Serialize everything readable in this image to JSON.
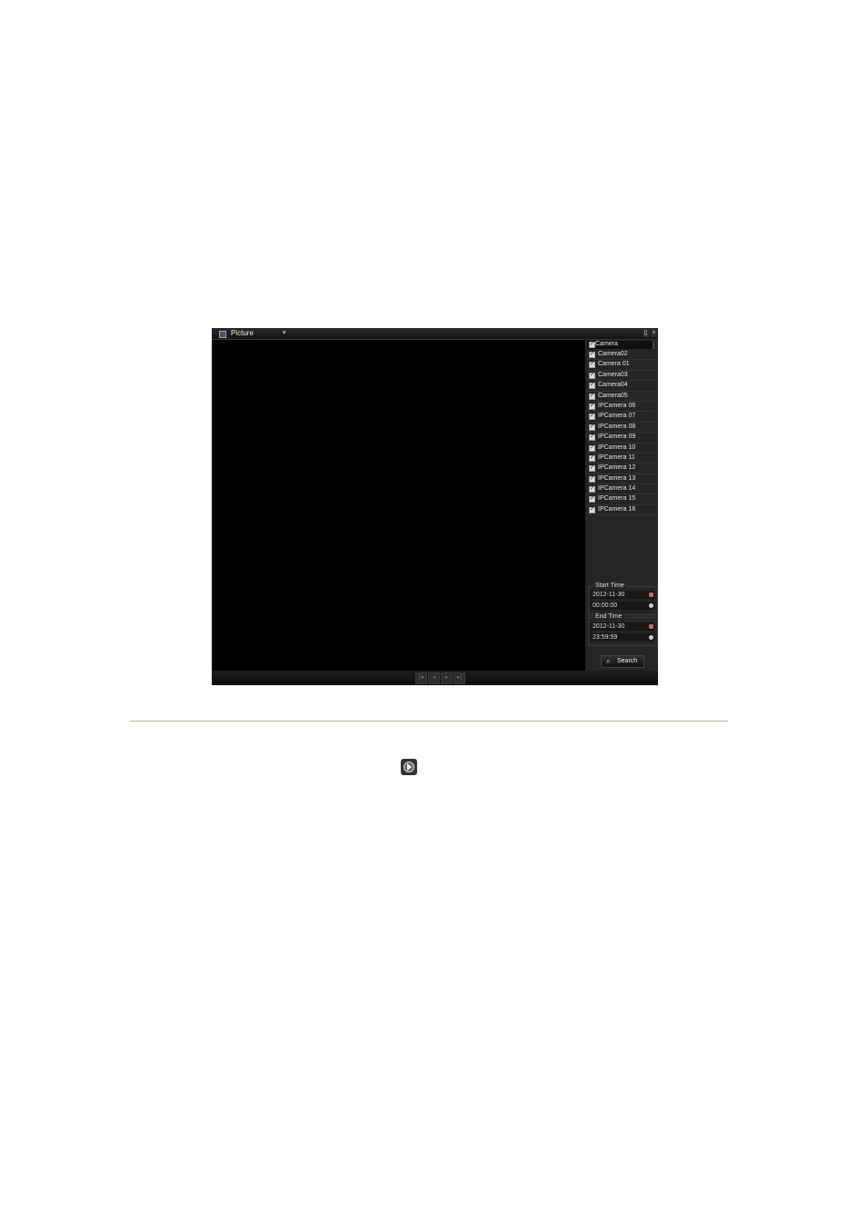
{
  "window": {
    "mode_label": "Picture",
    "dropdown_arrow": "▾",
    "maximize_glyph": "▯",
    "close_glyph": "×"
  },
  "camera_panel": {
    "header_label": "Camera",
    "items": [
      {
        "label": "Camera02"
      },
      {
        "label": "Camera 01"
      },
      {
        "label": "Camera03"
      },
      {
        "label": "Camera04"
      },
      {
        "label": "Camera05"
      },
      {
        "label": "IPCamera 06"
      },
      {
        "label": "IPCamera 07"
      },
      {
        "label": "IPCamera 08"
      },
      {
        "label": "IPCamera 09"
      },
      {
        "label": "IPCamera 10"
      },
      {
        "label": "IPCamera 11"
      },
      {
        "label": "IPCamera 12"
      },
      {
        "label": "IPCamera 13"
      },
      {
        "label": "IPCamera 14"
      },
      {
        "label": "IPCamera 15"
      },
      {
        "label": "IPCamera 16"
      }
    ],
    "check_glyph": "✓"
  },
  "start_time": {
    "legend": "Start Time",
    "date": "2012-11-30",
    "time": "00:00:00"
  },
  "end_time": {
    "legend": "End Time",
    "date": "2012-11-30",
    "time": "23:59:59"
  },
  "search": {
    "label": "Search",
    "icon": "magnifier-icon",
    "glyph": "⌕"
  },
  "nav": {
    "first": "|◂",
    "prev": "◂",
    "next": "▸",
    "last": "▸|"
  },
  "colors": {
    "panel": "#252525",
    "video": "#000000",
    "divider": "#b8b49a"
  }
}
